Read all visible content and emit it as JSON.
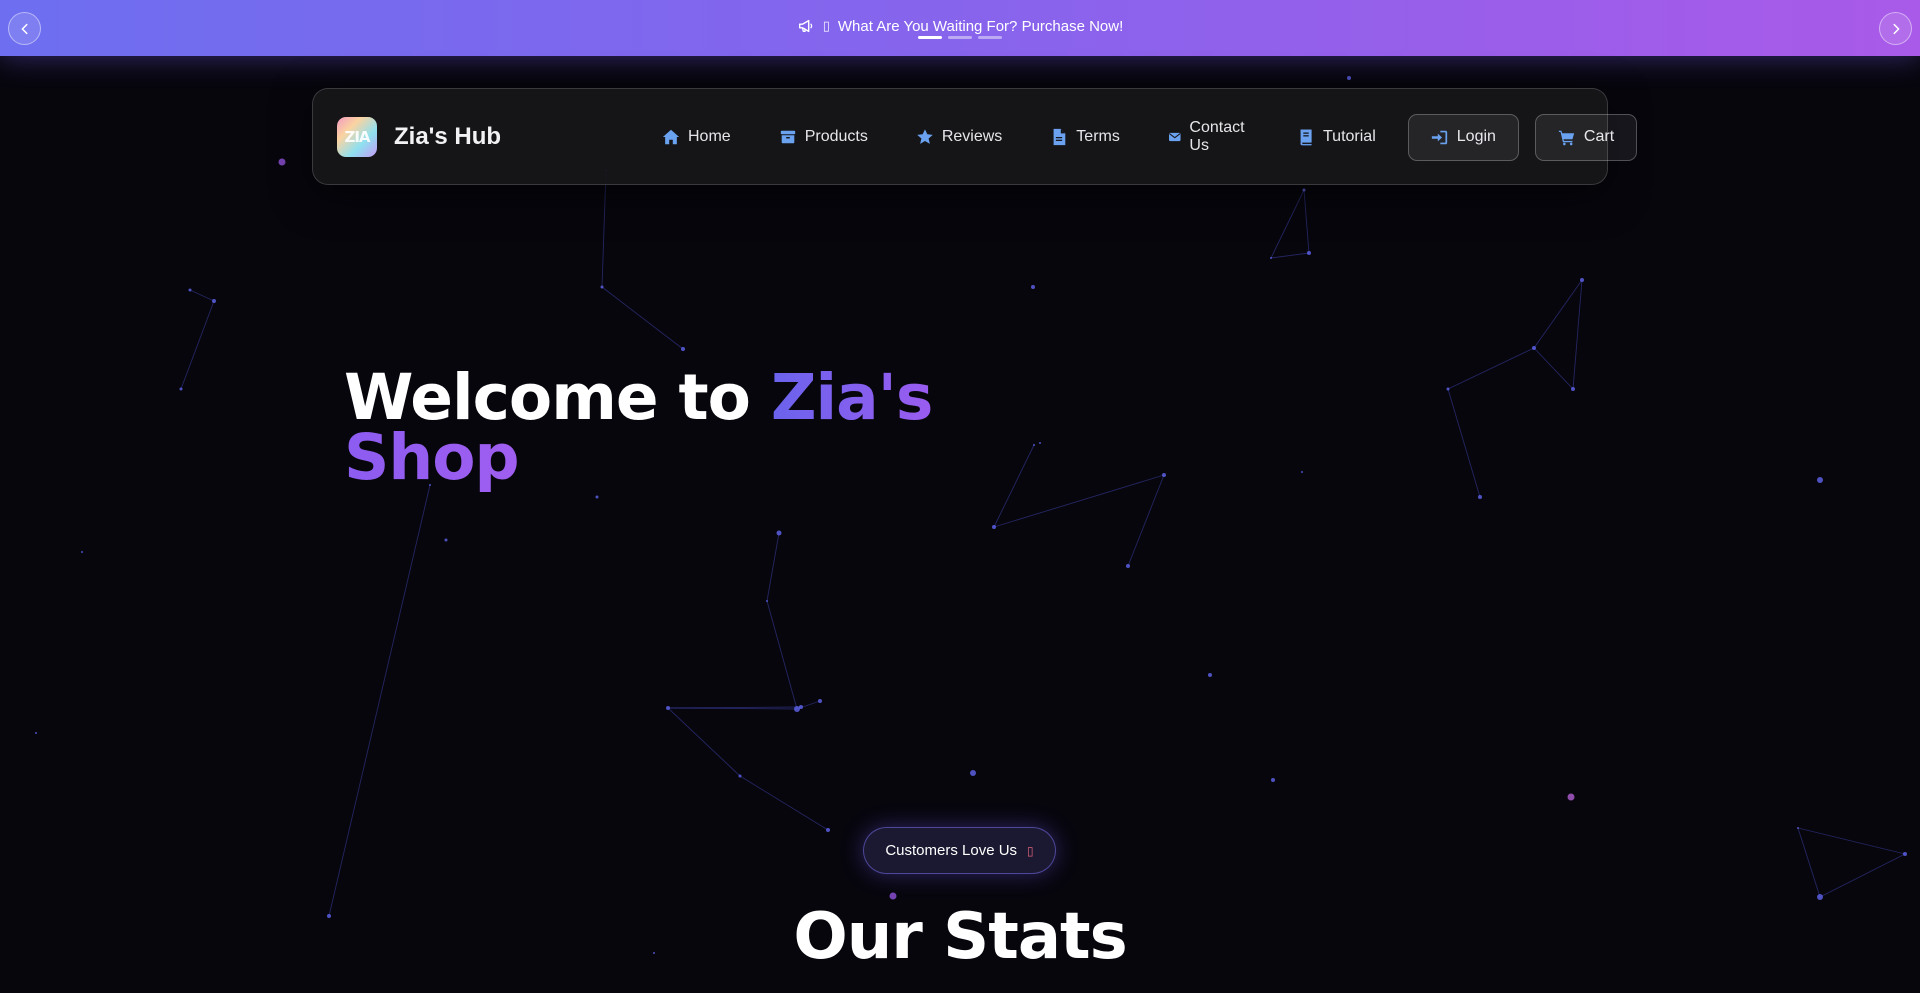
{
  "announcement": {
    "text": "What Are You Waiting For? Purchase Now!",
    "glyph": "▯",
    "icon": "megaphone-icon",
    "slide_count": 3,
    "active_slide": 1
  },
  "brand": {
    "logo_text": "ZIA",
    "name": "Zia's Hub"
  },
  "nav": {
    "links": [
      {
        "label": "Home",
        "icon": "home-icon"
      },
      {
        "label": "Products",
        "icon": "box-icon"
      },
      {
        "label": "Reviews",
        "icon": "star-icon"
      },
      {
        "label": "Terms",
        "icon": "document-icon"
      },
      {
        "label": "Contact Us",
        "icon": "envelope-icon"
      },
      {
        "label": "Tutorial",
        "icon": "book-icon"
      }
    ],
    "login_label": "Login",
    "cart_label": "Cart"
  },
  "hero": {
    "title_prefix": "Welcome to ",
    "title_accent_1": "Zia's",
    "title_accent_2": "Shop"
  },
  "badge": {
    "label": "Customers Love Us",
    "glyph": "▯"
  },
  "stats": {
    "title": "Our Stats"
  },
  "colors": {
    "background": "#07060d",
    "announcement_start": "#6d6ef0",
    "announcement_end": "#a95ae8",
    "accent": "#6a63ec",
    "icon": "#6aa2f0"
  }
}
